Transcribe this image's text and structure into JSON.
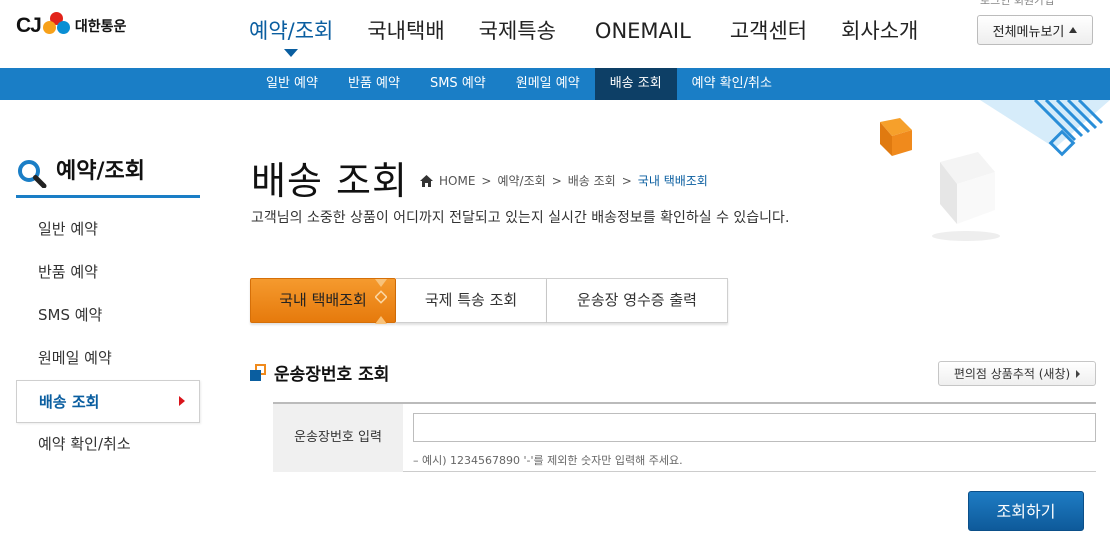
{
  "logo": {
    "cj": "CJ",
    "brand": "대한통운"
  },
  "gnb": [
    "예약/조회",
    "국내택배",
    "국제특송",
    "ONEMAIL",
    "고객센터",
    "회사소개"
  ],
  "all_menu_label": "전체메뉴보기",
  "top_cut_text": "로그인  회원가입",
  "subnav": [
    "일반 예약",
    "반품 예약",
    "SMS 예약",
    "원메일 예약",
    "배송 조회",
    "예약 확인/취소"
  ],
  "lnb": {
    "title": "예약/조회",
    "items": [
      "일반 예약",
      "반품 예약",
      "SMS 예약",
      "원메일 예약",
      "배송 조회",
      "예약 확인/취소"
    ]
  },
  "page": {
    "title": "배송 조회",
    "breadcrumb": [
      "HOME",
      "예약/조회",
      "배송 조회",
      "국내 택배조회"
    ],
    "description": "고객님의 소중한 상품이 어디까지 전달되고 있는지 실시간 배송정보를 확인하실 수 있습니다."
  },
  "tabs": [
    "국내 택배조회",
    "국제 특송 조회",
    "운송장 영수증 출력"
  ],
  "section": {
    "title": "운송장번호 조회",
    "conv_button": "편의점 상품추적 (새창)",
    "field_label": "운송장번호 입력",
    "input_value": "",
    "hint": "– 예시) 1234567890 '-'를 제외한 숫자만 입력해 주세요.",
    "search_button": "조회하기"
  },
  "colors": {
    "primary": "#1a7ec6",
    "dark": "#0d3f66",
    "orange": "#f08a1c",
    "arrow_red": "#d9141b"
  }
}
